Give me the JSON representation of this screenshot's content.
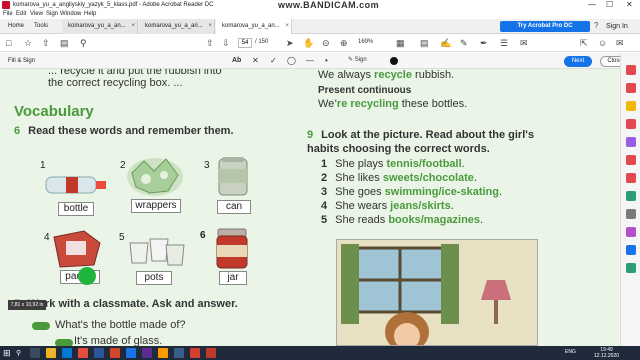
{
  "window": {
    "title": "komarova_yu_a_angliyskiy_yazyk_5_klass.pdf - Adobe Acrobat Reader DC",
    "watermark": "www.BANDICAM.com",
    "controls": [
      "—",
      "☐",
      "✕"
    ]
  },
  "menu": [
    "File",
    "Edit",
    "View",
    "Sign",
    "Window",
    "Help"
  ],
  "tabs": {
    "home": "Home",
    "tools": "Tools",
    "docs": [
      {
        "label": "komarova_yu_a_an...",
        "close": "×"
      },
      {
        "label": "komarova_yu_a_ari...",
        "close": "×"
      },
      {
        "label": "komarova_yu_a_an...",
        "close": "×"
      }
    ],
    "try_button": "Try Acrobat Pro DC",
    "help": "?",
    "bell": "🔔",
    "sign_in": "Sign In"
  },
  "toolbar": {
    "page_current": "54",
    "page_total": "/ 150",
    "zoom": "169%"
  },
  "fill_sign": {
    "label": "Fill & Sign",
    "text_tool": "Ab",
    "sign": "Sign",
    "next": "Next",
    "close": "Close"
  },
  "document": {
    "cut_top_line1": "... recycle it and put the rubbish into",
    "cut_top_line2": "the correct recycling box. ...",
    "vocabulary": "Vocabulary",
    "ex6": {
      "num": "6",
      "text": "Read these words and remember them."
    },
    "items": [
      {
        "n": "1",
        "label": "bottle"
      },
      {
        "n": "2",
        "label": "wrappers"
      },
      {
        "n": "3",
        "label": "can"
      },
      {
        "n": "4",
        "label": "packet"
      },
      {
        "n": "5",
        "label": "pots"
      },
      {
        "n": "6",
        "label": "jar"
      }
    ],
    "ex7": {
      "num": "7",
      "text": "Work with a classmate. Ask and answer."
    },
    "q1": "What's the bottle made of?",
    "q2": "It's made of glass.",
    "tooltip": "7,81 x 10,92 in",
    "right_top1_a": "We always ",
    "right_top1_b": "recycle",
    "right_top1_c": " rubbish.",
    "present_continuous": "Present continuous",
    "right_top2_a": "We",
    "right_top2_b": "'re recycling",
    "right_top2_c": " these bottles.",
    "ex9": {
      "num": "9",
      "text": "Look at the picture. Read about the girl's habits choosing the correct words."
    },
    "sentences": [
      {
        "n": "1",
        "a": "She plays ",
        "b": "tennis/football",
        "c": "."
      },
      {
        "n": "2",
        "a": "She likes ",
        "b": "sweets/chocolate",
        "c": "."
      },
      {
        "n": "3",
        "a": "She goes ",
        "b": "swimming/ice-skating",
        "c": "."
      },
      {
        "n": "4",
        "a": "She wears ",
        "b": "jeans/skirts",
        "c": "."
      },
      {
        "n": "5",
        "a": "She reads ",
        "b": "books/magazines",
        "c": "."
      }
    ]
  },
  "taskbar": {
    "lang": "ENG",
    "time": "19:49",
    "date": "12.12.2020"
  },
  "colors": {
    "accent_blue": "#1473e6",
    "book_green": "#4a9a3c",
    "page_bg": "#eaf5e8"
  }
}
